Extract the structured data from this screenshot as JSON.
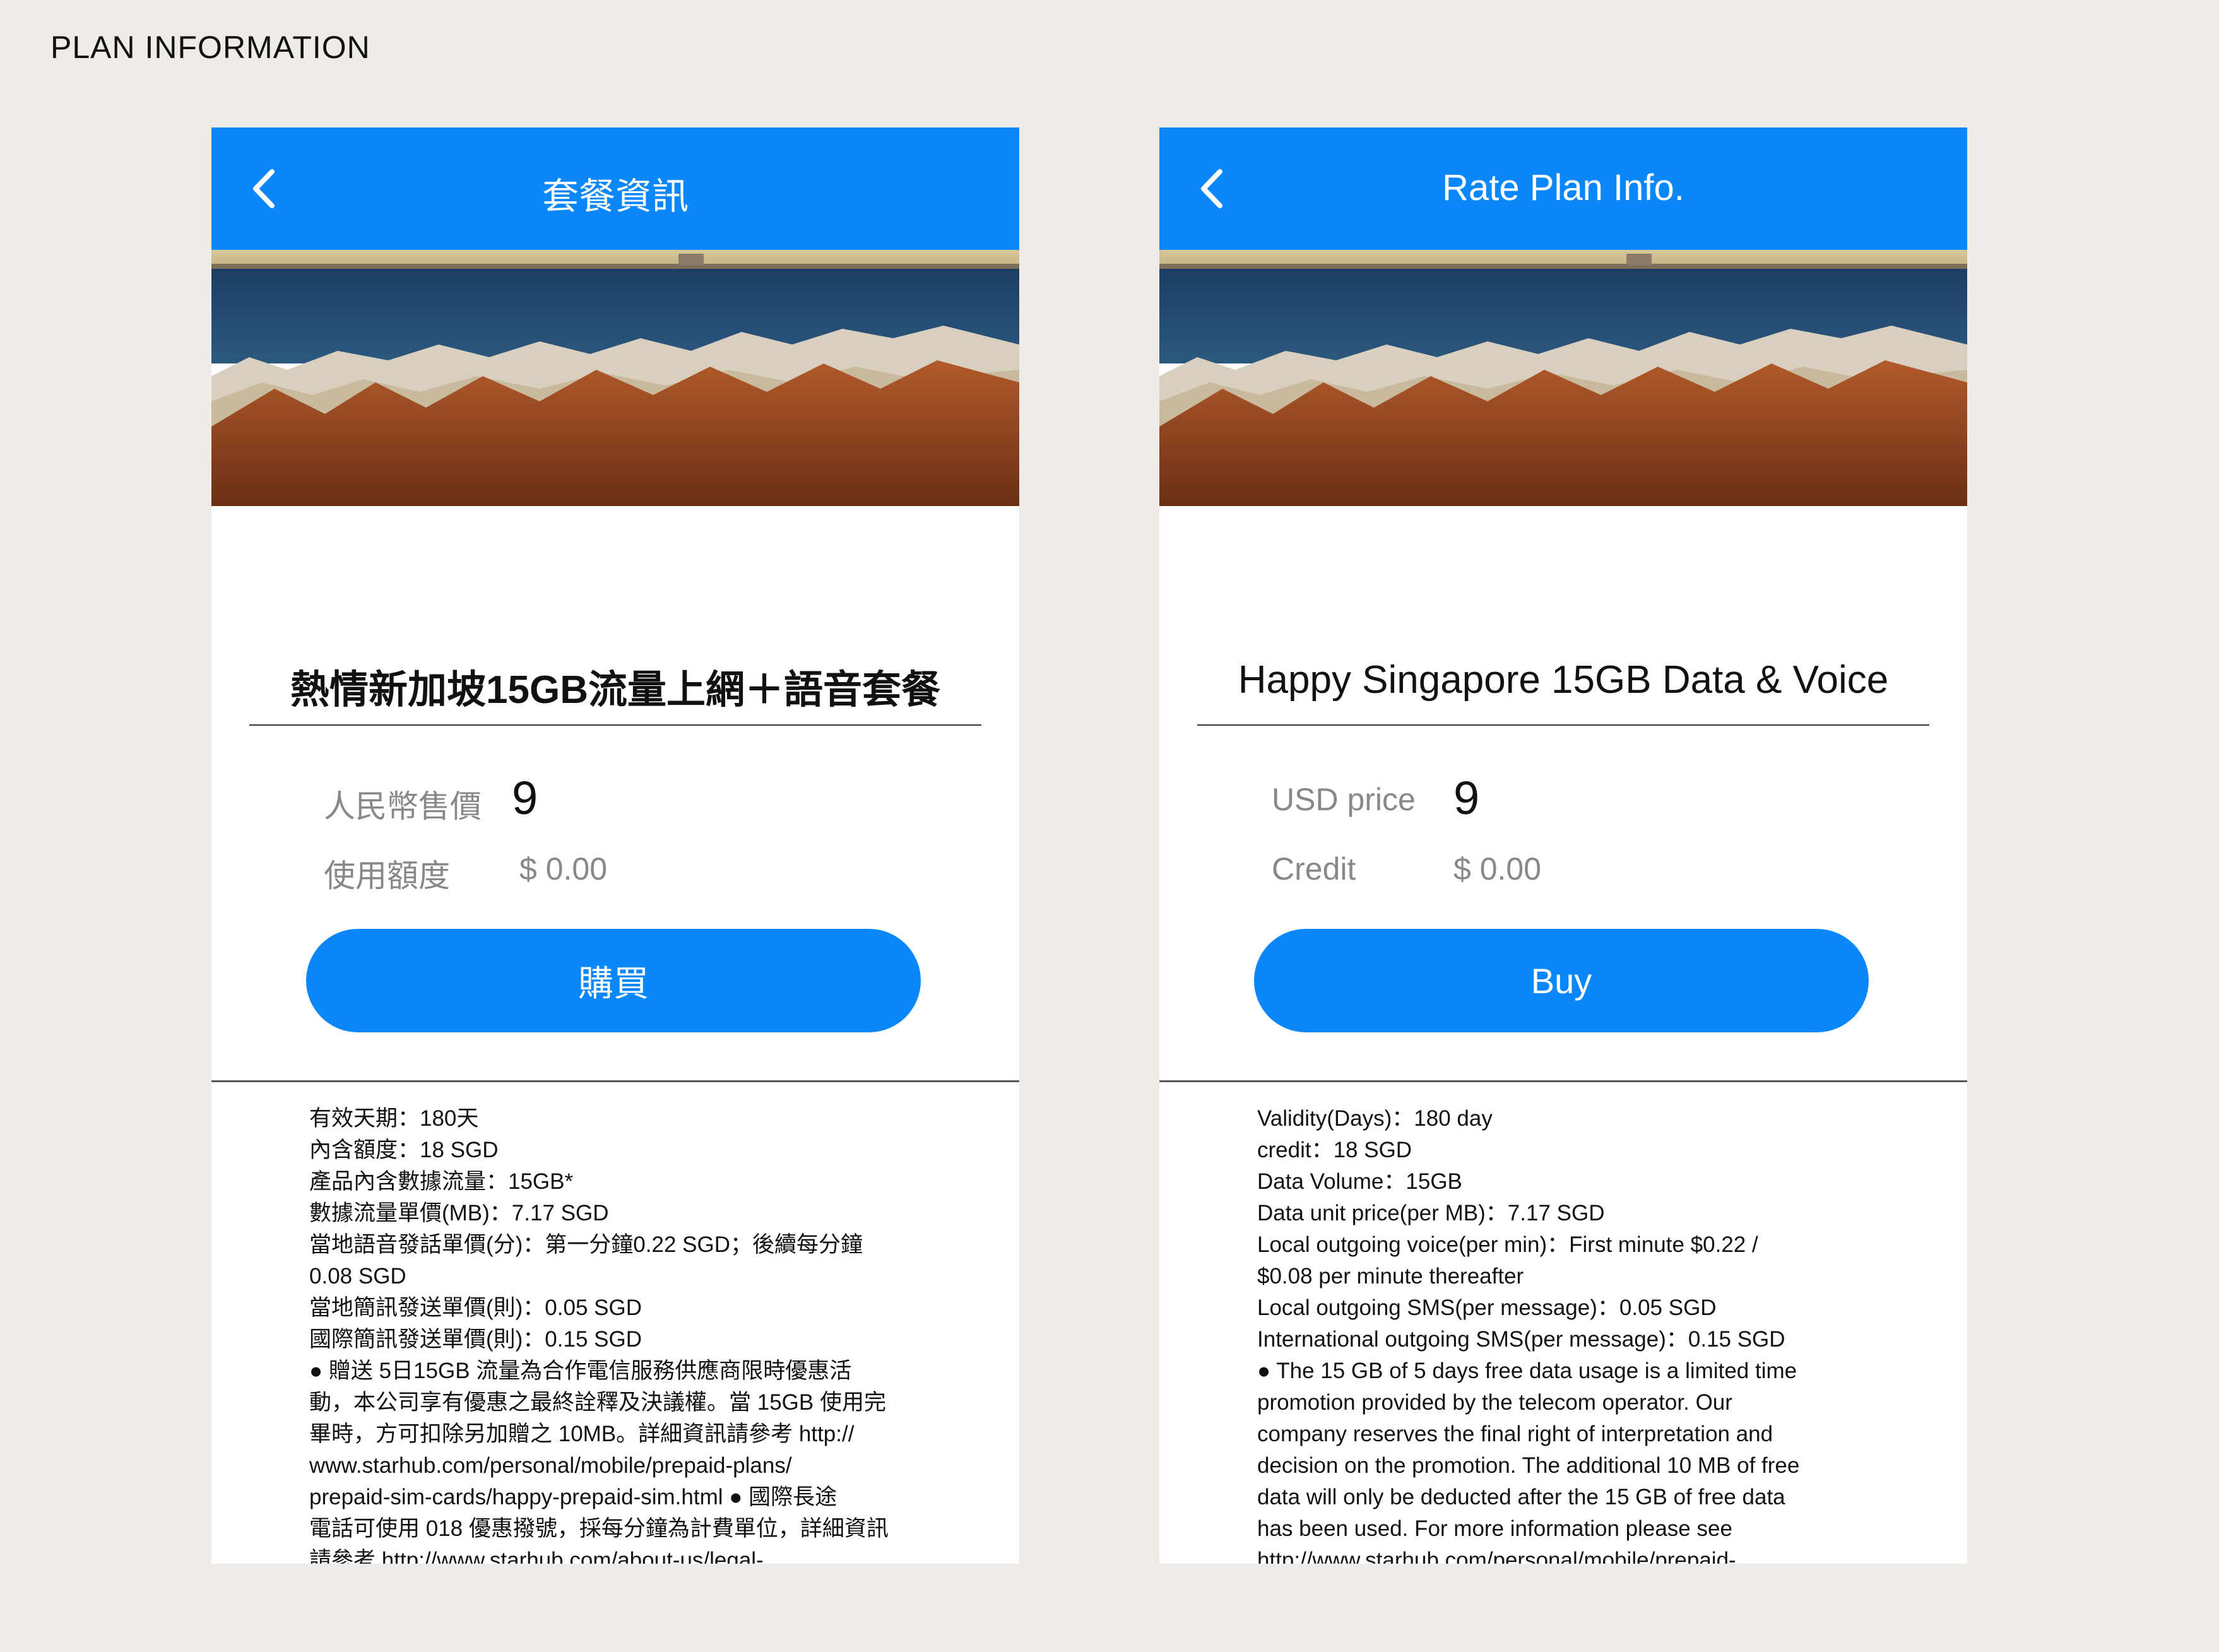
{
  "page_title": "PLAN INFORMATION",
  "colors": {
    "accent": "#0a87fa",
    "background": "#efece8"
  },
  "screens": [
    {
      "header_title": "套餐資訊",
      "plan_name": "熱情新加坡15GB流量上網＋語音套餐",
      "price_label": "人民幣售價",
      "price_value": "9",
      "credit_label": "使用額度",
      "credit_value": "$ 0.00",
      "buy_label": "購買",
      "details": [
        "有效天期：180天",
        "內含額度：18 SGD",
        "產品內含數據流量：15GB*",
        "數據流量單價(MB)：7.17 SGD",
        "當地語音發話單價(分)：第一分鐘0.22 SGD；後續每分鐘",
        "0.08 SGD",
        "當地簡訊發送單價(則)：0.05 SGD",
        "國際簡訊發送單價(則)：0.15 SGD",
        "● 贈送 5日15GB 流量為合作電信服務供應商限時優惠活",
        "動，本公司享有優惠之最終詮釋及決議權。當 15GB 使用完",
        "畢時，方可扣除另加贈之 10MB。詳細資訊請參考 http://",
        "www.starhub.com/personal/mobile/prepaid-plans/",
        "prepaid-sim-cards/happy-prepaid-sim.html ● 國際長途",
        "電話可使用 018 優惠撥號，採每分鐘為計費單位，詳細資訊",
        "請參考 http://www.starhub.com/about-us/legal-"
      ]
    },
    {
      "header_title": "Rate Plan Info.",
      "plan_name": "Happy Singapore 15GB Data & Voice",
      "price_label": "USD price",
      "price_value": "9",
      "credit_label": "Credit",
      "credit_value": "$ 0.00",
      "buy_label": "Buy",
      "details": [
        "Validity(Days)：180 day",
        "credit：18 SGD",
        "Data Volume：15GB",
        "Data unit price(per MB)：7.17 SGD",
        "Local outgoing voice(per min)：First minute $0.22 /",
        "$0.08 per minute thereafter",
        "Local outgoing SMS(per message)：0.05 SGD",
        "International outgoing SMS(per message)：0.15 SGD",
        "● The 15 GB of 5 days free data usage is a limited time",
        "promotion provided by the telecom operator. Our",
        "company reserves the final right of interpretation and",
        "decision on the promotion. The additional 10 MB of free",
        "data will only be deducted after the 15 GB of free data",
        "has been used. For more information please see",
        "http://www.starhub.com/personal/mobile/prepaid-"
      ]
    }
  ]
}
